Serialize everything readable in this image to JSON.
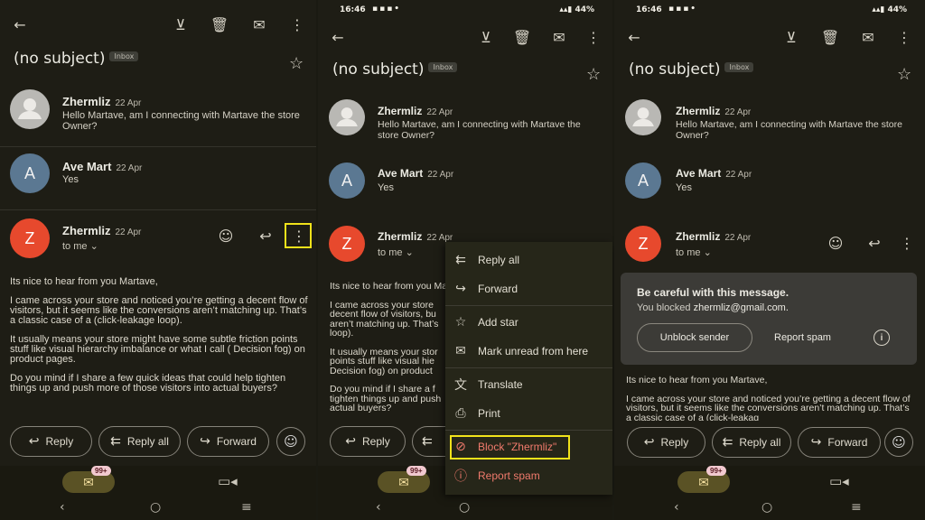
{
  "status_bar": {
    "time": "16:46",
    "battery": "44%"
  },
  "email": {
    "subject": "(no subject)",
    "label": "Inbox",
    "messages": [
      {
        "sender": "Zhermliz",
        "date": "22 Apr",
        "snippet": "Hello Martave, am I connecting with Martave the store Owner?",
        "avatar": "person-icon"
      },
      {
        "sender": "Ave Mart",
        "date": "22 Apr",
        "snippet": "Yes",
        "avatar_letter": "A"
      },
      {
        "sender": "Zhermliz",
        "date": "22 Apr",
        "recipient": "to me",
        "avatar_letter": "Z"
      }
    ],
    "body": [
      "Its nice to hear from you Martave,",
      "I came across your store and noticed you’re getting a decent flow of visitors, but it seems like the conversions aren’t matching up. That’s a classic case of a (click-leakage loop).",
      "It usually means your store might have some subtle friction points stuff like visual hierarchy imbalance or what I call ( Decision fog) on product pages.",
      "Do you mind if I share a few quick ideas that could help tighten things up and push more of those visitors into actual buyers?"
    ],
    "body_panel2": [
      "Its nice to hear from you Ma",
      "I came across your store\ndecent flow of visitors, bu\naren’t matching up. That’s\nloop).",
      "It usually means your stor\npoints stuff like visual hie\nDecision fog) on product",
      "Do you mind if I share a f\ntighten things up and push\nactual buyers?"
    ],
    "body_panel3_intro": "Its nice to hear from you Martave,",
    "body_panel3_partial": "I came across your store and noticed you’re getting a decent flow of visitors, but it seems like the conversions aren’t matching up. That’s a classic case of a (click-leakag"
  },
  "actions": {
    "reply": "Reply",
    "reply_all": "Reply all",
    "forward": "Forward"
  },
  "menu": {
    "items": [
      {
        "label": "Reply all",
        "icon": "reply-all-icon"
      },
      {
        "label": "Forward",
        "icon": "forward-icon"
      },
      {
        "label": "Add star",
        "icon": "star-icon"
      },
      {
        "label": "Mark unread from here",
        "icon": "mark-unread-icon"
      },
      {
        "label": "Translate",
        "icon": "translate-icon"
      },
      {
        "label": "Print",
        "icon": "print-icon"
      },
      {
        "label": "Block \"Zhermliz\"",
        "icon": "block-icon"
      },
      {
        "label": "Report spam",
        "icon": "report-icon"
      }
    ]
  },
  "warning": {
    "title": "Be careful with this message.",
    "prefix": "You blocked",
    "email": "zhermliz@gmail.com.",
    "unblock": "Unblock sender",
    "report": "Report spam"
  },
  "nav": {
    "mail_badge": "99+"
  },
  "colors": {
    "highlight": "#f1e21a",
    "danger": "#f07a6c",
    "avatar_red": "#e7492d",
    "avatar_blue": "#5b7892"
  }
}
